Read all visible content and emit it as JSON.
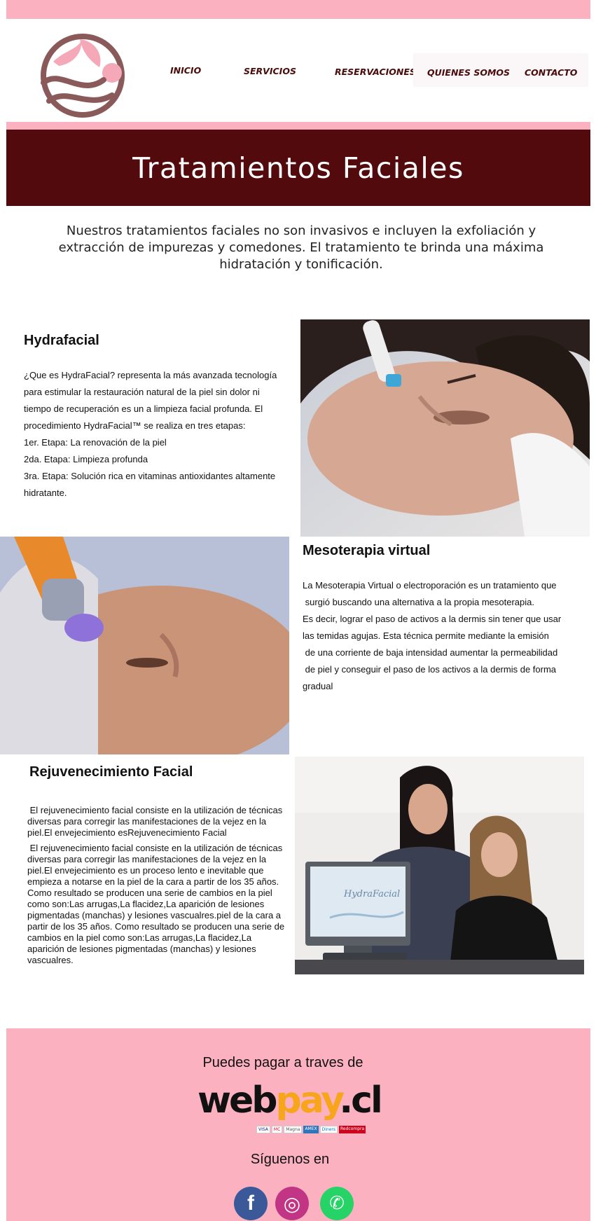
{
  "nav": {
    "items": [
      {
        "label": "INICIO"
      },
      {
        "label": "SERVICIOS"
      },
      {
        "label": "RESERVACIONES"
      },
      {
        "label": "QUIENES SOMOS"
      },
      {
        "label": "CONTACTO"
      }
    ]
  },
  "colors": {
    "pink": "#fbb1c0",
    "maroon": "#520a0c",
    "nav_text": "#4a0b0b"
  },
  "banner": {
    "title": "Tratamientos Faciales"
  },
  "intro": {
    "text": "Nuestros tratamientos faciales no son invasivos e incluyen la exfoliación y extracción  de impurezas y  comedones. El tratamiento te brinda una máxima hidratación y tonificación."
  },
  "hydrafacial": {
    "title": "Hydrafacial",
    "paragraph": "¿Que es HydraFacial? representa la más avanzada tecnología para estimular la restauración natural de la piel sin dolor ni tiempo de recuperación es un a limpieza facial profunda. El procedimiento HydraFacial™ se realiza en tres etapas:",
    "steps": [
      "1er. Etapa: La renovación de la piel",
      "2da. Etapa: Limpieza profunda",
      "3ra. Etapa: Solución rica en vitaminas antioxidantes altamente hidratante."
    ]
  },
  "mesoterapia": {
    "title": "Mesoterapia virtual",
    "lines": [
      "La Mesoterapia Virtual o electroporación es un tratamiento que",
      " surgió buscando una alternativa a la propia mesoterapia.",
      "Es decir, lograr el paso de activos a la dermis sin tener que usar",
      "las temidas agujas. Esta técnica permite mediante la emisión",
      " de una corriente de baja intensidad aumentar la permeabilidad",
      " de piel y conseguir el paso de los activos a la dermis de forma",
      "gradual"
    ]
  },
  "rejuvenecimiento": {
    "title": "Rejuvenecimiento Facial",
    "paragraph1": " El rejuvenecimiento facial consiste en la utilización de técnicas diversas para corregir las manifestaciones de la vejez en la piel.El envejecimiento esRejuvenecimiento Facial",
    "paragraph2": " El rejuvenecimiento facial consiste en la utilización de técnicas diversas para corregir las manifestaciones de la vejez en la piel.El envejecimiento es un proceso lento e inevitable que empieza a notarse en la piel de la cara a partir de los 35 años. Como resultado se producen una serie de cambios en la piel como son:Las arrugas,La flacidez,La aparición de lesiones pigmentadas (manchas) y lesiones vascualres.piel de la cara a partir de los 35 años. Como resultado se producen una serie de cambios en la piel como son:Las arrugas,La flacidez,La aparición de lesiones pigmentadas (manchas) y lesiones vascualres."
  },
  "monitor_brand": "HydraFacial",
  "footer": {
    "pay_title": "Puedes pagar a traves de",
    "webpay_web": "web",
    "webpay_pay": "pay",
    "webpay_cl": ".cl",
    "cards": [
      "VISA",
      "MC",
      "Magna",
      "AMEX",
      "Diners",
      "Redcompra"
    ],
    "follow_title": "Síguenos en",
    "social": [
      {
        "name": "facebook",
        "glyph": "f",
        "color": "#3b5998"
      },
      {
        "name": "instagram",
        "glyph": "◎",
        "color": "#c13584"
      },
      {
        "name": "whatsapp",
        "glyph": "✆",
        "color": "#25d366"
      }
    ]
  }
}
